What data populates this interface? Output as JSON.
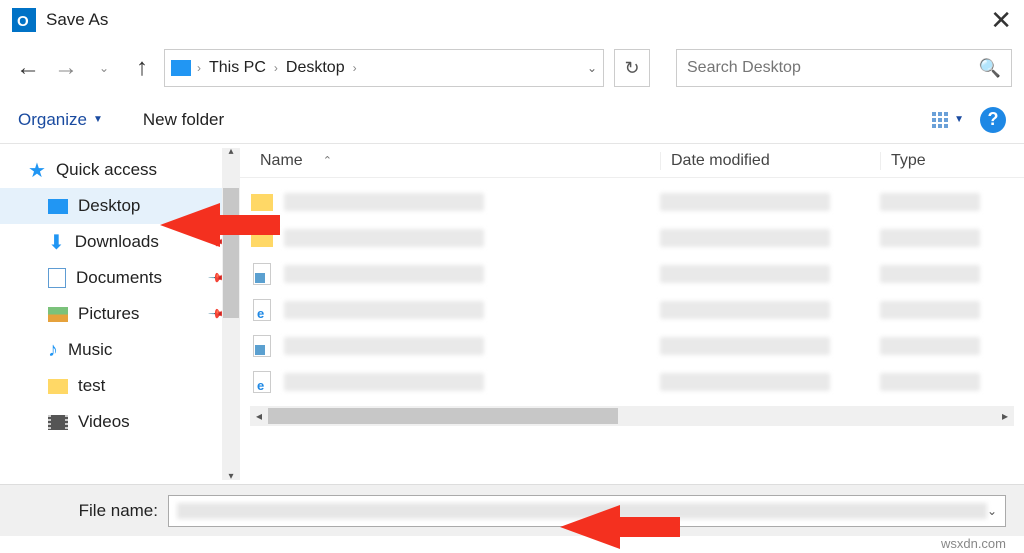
{
  "title": "Save As",
  "breadcrumb": {
    "items": [
      "This PC",
      "Desktop"
    ]
  },
  "search": {
    "placeholder": "Search Desktop"
  },
  "toolbar": {
    "organize": "Organize",
    "new_folder": "New folder"
  },
  "sidebar": {
    "items": [
      {
        "label": "Quick access",
        "icon": "star"
      },
      {
        "label": "Desktop",
        "icon": "desktop",
        "selected": true
      },
      {
        "label": "Downloads",
        "icon": "download",
        "pinned": true
      },
      {
        "label": "Documents",
        "icon": "doc",
        "pinned": true
      },
      {
        "label": "Pictures",
        "icon": "pics",
        "pinned": true
      },
      {
        "label": "Music",
        "icon": "music"
      },
      {
        "label": "test",
        "icon": "folder"
      },
      {
        "label": "Videos",
        "icon": "videos"
      }
    ]
  },
  "columns": {
    "name": "Name",
    "date": "Date modified",
    "type": "Type"
  },
  "rows": [
    {
      "icon": "folder"
    },
    {
      "icon": "folder"
    },
    {
      "icon": "file-p"
    },
    {
      "icon": "file-e"
    },
    {
      "icon": "file-p"
    },
    {
      "icon": "file-e"
    }
  ],
  "filebar": {
    "label": "File name:"
  },
  "footer": "wsxdn.com"
}
